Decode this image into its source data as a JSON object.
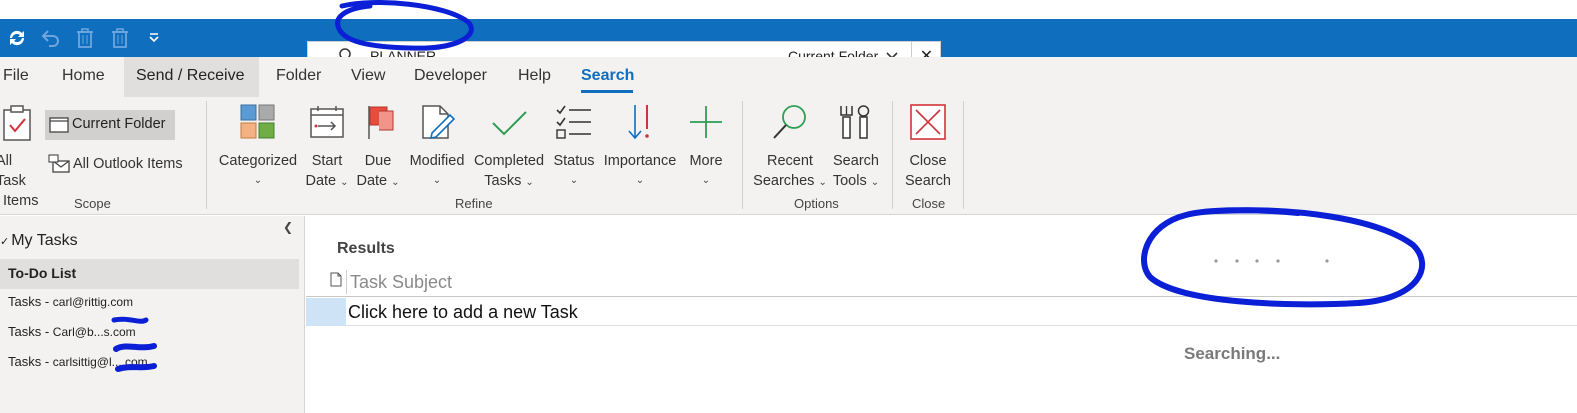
{
  "search": {
    "query": "PLANNER",
    "scope_label": "Current Folder",
    "close_glyph": "✕"
  },
  "tabs": [
    {
      "label": "File"
    },
    {
      "label": "Home"
    },
    {
      "label": "Send / Receive"
    },
    {
      "label": "Folder"
    },
    {
      "label": "View"
    },
    {
      "label": "Developer"
    },
    {
      "label": "Help"
    },
    {
      "label": "Search"
    }
  ],
  "active_tab": "Search",
  "ribbon": {
    "scope": {
      "all_task_items_l1": "All Task",
      "all_task_items_l2": "Items",
      "current_folder": "Current Folder",
      "all_outlook_items": "All Outlook Items",
      "group_label": "Scope"
    },
    "refine": {
      "categorized": "Categorized",
      "start_date_l1": "Start",
      "start_date_l2": "Date",
      "due_date_l1": "Due",
      "due_date_l2": "Date",
      "modified": "Modified",
      "completed_l1": "Completed",
      "completed_l2": "Tasks",
      "status": "Status",
      "importance": "Importance",
      "more": "More",
      "group_label": "Refine"
    },
    "options": {
      "recent_l1": "Recent",
      "recent_l2": "Searches",
      "tools_l1": "Search",
      "tools_l2": "Tools",
      "group_label": "Options"
    },
    "close": {
      "close_l1": "Close",
      "close_l2": "Search",
      "group_label": "Close"
    }
  },
  "nav": {
    "root": "My Tasks",
    "items": [
      {
        "label": "To-Do List",
        "selected": true
      },
      {
        "prefix": "Tasks - ",
        "account": "carl@rittig.com"
      },
      {
        "prefix": "Tasks - ",
        "account": "Carl@b...s.com"
      },
      {
        "prefix": "Tasks - ",
        "account": "carlsittig@l....com"
      }
    ]
  },
  "main": {
    "results_title": "Results",
    "column_task_subject": "Task Subject",
    "new_task_placeholder": "Click here to add a new Task",
    "status_text": "Searching..."
  },
  "colors": {
    "titlebar": "#106ebe",
    "accent": "#106ebe",
    "annotation": "#0a1fd6",
    "ribbon_bg": "#f3f2f1"
  }
}
